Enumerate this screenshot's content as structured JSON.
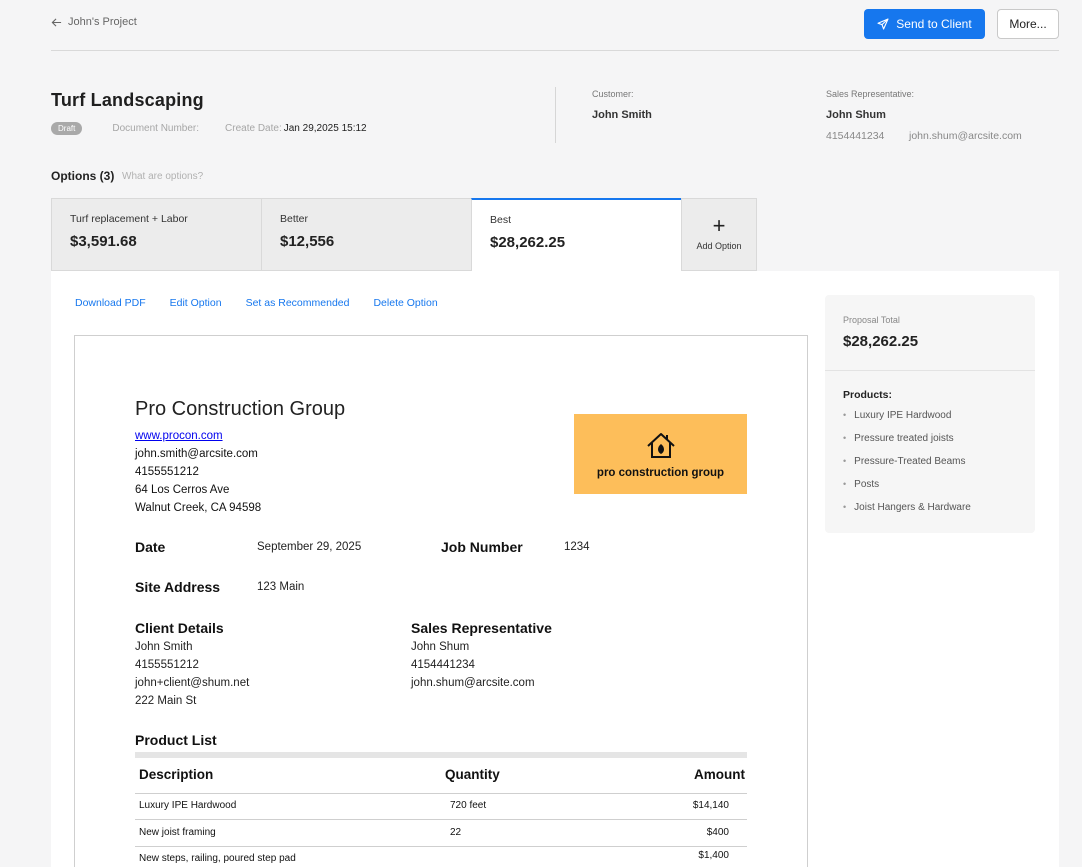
{
  "header": {
    "back_label": "John's Project",
    "send_label": "Send to Client",
    "more_label": "More..."
  },
  "document": {
    "title": "Turf Landscaping",
    "status": "Draft",
    "doc_number_label": "Document Number:",
    "create_date_label": "Create Date:",
    "create_date": "Jan 29,2025 15:12"
  },
  "customer": {
    "label": "Customer:",
    "name": "John Smith"
  },
  "sales_rep": {
    "label": "Sales Representative:",
    "name": "John Shum",
    "phone": "4154441234",
    "email": "john.shum@arcsite.com"
  },
  "options": {
    "title": "Options (3)",
    "help": "What are options?",
    "tabs": [
      {
        "label": "Turf replacement + Labor",
        "price": "$3,591.68"
      },
      {
        "label": "Better",
        "price": "$12,556"
      },
      {
        "label": "Best",
        "price": "$28,262.25"
      }
    ],
    "add_label": "Add Option",
    "add_icon": "+"
  },
  "actions": {
    "download": "Download PDF",
    "edit": "Edit Option",
    "recommend": "Set as Recommended",
    "delete": "Delete Option"
  },
  "proposal": {
    "company": "Pro Construction Group",
    "website": "www.procon.com",
    "email": "john.smith@arcsite.com",
    "phone": "4155551212",
    "address1": "64 Los Cerros Ave",
    "address2": "Walnut Creek, CA 94598",
    "logo_text": "pro construction group",
    "date_label": "Date",
    "date": "September 29, 2025",
    "job_label": "Job Number",
    "job": "1234",
    "site_label": "Site Address",
    "site": "123 Main",
    "client_label": "Client Details",
    "client": [
      "John Smith",
      "4155551212",
      "john+client@shum.net",
      "222 Main St"
    ],
    "rep_label": "Sales Representative",
    "rep": [
      "John Shum",
      "4154441234",
      "john.shum@arcsite.com"
    ],
    "product_list_label": "Product List",
    "col_desc": "Description",
    "col_qty": "Quantity",
    "col_amt": "Amount",
    "rows": [
      {
        "desc": "Luxury IPE Hardwood",
        "qty": "720 feet",
        "amt": "$14,140"
      },
      {
        "desc": "New joist framing",
        "qty": "22",
        "amt": "$400"
      },
      {
        "desc": "New steps, railing, poured step pad",
        "qty": "",
        "amt": "$1,400"
      }
    ]
  },
  "summary": {
    "total_label": "Proposal Total",
    "total": "$28,262.25",
    "products_label": "Products:",
    "products": [
      "Luxury IPE Hardwood",
      "Pressure treated joists",
      "Pressure-Treated Beams",
      "Posts",
      "Joist Hangers & Hardware"
    ]
  },
  "colors": {
    "accent": "#1677ee",
    "logo_bg": "#fdbe5a"
  },
  "icons": {
    "back": "arrow-left-icon",
    "send": "paper-plane-icon",
    "logo": "house-leaf-icon"
  }
}
